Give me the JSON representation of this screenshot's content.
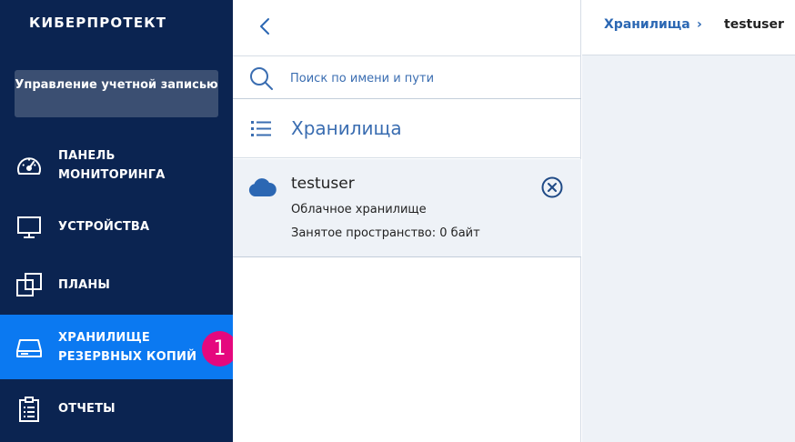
{
  "sidebar": {
    "logo": "КИБЕРПРОТЕКТ",
    "account_button": "Управление учетной записью",
    "items": [
      {
        "label_line1": "ПАНЕЛЬ",
        "label_line2": "МОНИТОРИНГА",
        "icon": "dashboard-gauge-icon"
      },
      {
        "label_line1": "УСТРОЙСТВА",
        "icon": "monitor-icon"
      },
      {
        "label_line1": "ПЛАНЫ",
        "icon": "plans-squares-icon"
      },
      {
        "label_line1": "ХРАНИЛИЩЕ",
        "label_line2": "РЕЗЕРВНЫХ КОПИЙ",
        "icon": "storage-drive-icon",
        "active": true
      },
      {
        "label_line1": "ОТЧЕТЫ",
        "icon": "clipboard-report-icon"
      }
    ],
    "badge": "1"
  },
  "middle": {
    "search_placeholder": "Поиск по имени и пути",
    "list_title": "Хранилища",
    "storage": {
      "name": "testuser",
      "type": "Облачное хранилище",
      "used": "Занятое пространство: 0 байт"
    }
  },
  "breadcrumb": {
    "parent": "Хранилища",
    "separator": "›",
    "current": "testuser"
  },
  "colors": {
    "sidebar_bg": "#0b2451",
    "active_bg": "#0b79f1",
    "badge_bg": "#e5087e",
    "link": "#2b67b3"
  }
}
